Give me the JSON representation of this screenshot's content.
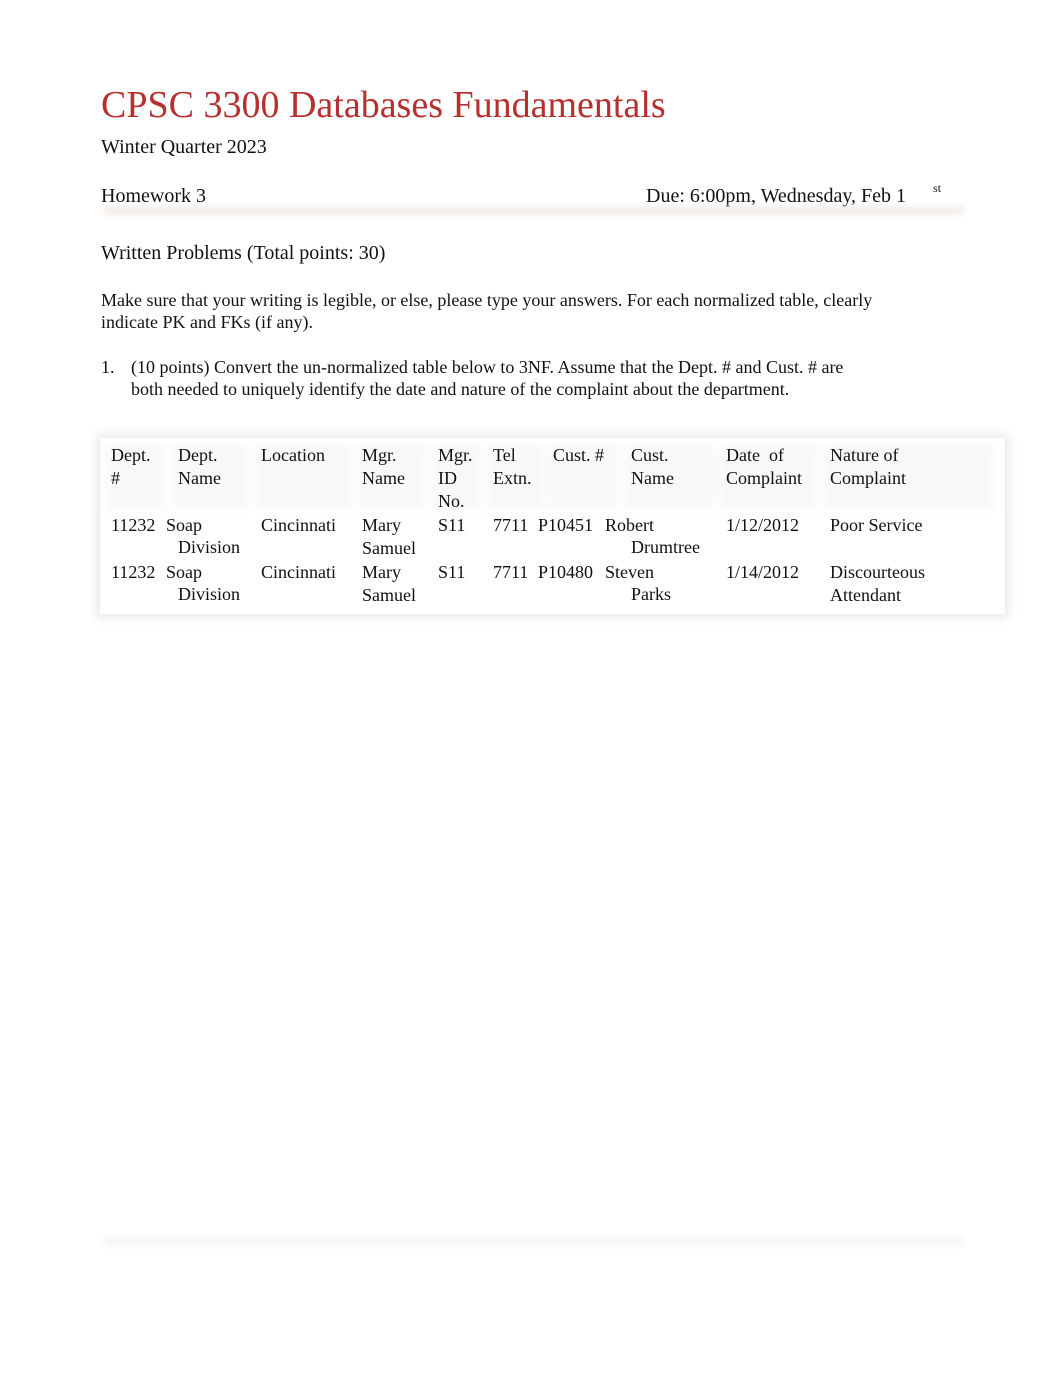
{
  "document": {
    "title": "CPSC 3300 Databases Fundamentals",
    "term": "Winter Quarter 2023",
    "assignment": "Homework 3",
    "due": "Due: 6:00pm, Wednesday, Feb 1",
    "due_suffix": "st",
    "section_heading": "Written Problems (Total points: 30)",
    "instructions": "Make sure that your writing is legible, or else, please type your answers. For each normalized table, clearly indicate PK and FKs (if any).",
    "problems": [
      {
        "number": "1.",
        "text": "(10 points) Convert the un-normalized table below to 3NF. Assume that the Dept. # and Cust. # are both needed to uniquely identify the date and nature of the complaint about the department."
      }
    ]
  },
  "table": {
    "headers": [
      [
        "Dept.",
        "#"
      ],
      [
        "Dept.",
        "Name"
      ],
      [
        "Location"
      ],
      [
        "Mgr.",
        "Name"
      ],
      [
        "Mgr.",
        "ID",
        "No."
      ],
      [
        "Tel",
        "Extn."
      ],
      [
        "Cust. #"
      ],
      [
        "Cust.",
        "Name"
      ],
      [
        "Date  of",
        "Complaint"
      ],
      [
        "Nature of",
        "Complaint"
      ]
    ],
    "rows": [
      {
        "dept_no": "11232",
        "dept_name": [
          "Soap",
          "Division"
        ],
        "location": "Cincinnati",
        "mgr_name": [
          "Mary",
          "Samuel"
        ],
        "mgr_id": "S11",
        "tel_extn": "7711",
        "cust_no": "P10451",
        "cust_name": [
          "Robert",
          "Drumtree"
        ],
        "date": "1/12/2012",
        "nature": [
          "Poor Service"
        ]
      },
      {
        "dept_no": "11232",
        "dept_name": [
          "Soap",
          "Division"
        ],
        "location": "Cincinnati",
        "mgr_name": [
          "Mary",
          "Samuel"
        ],
        "mgr_id": "S11",
        "tel_extn": "7711",
        "cust_no": "P10480",
        "cust_name": [
          "Steven",
          "Parks"
        ],
        "date": "1/14/2012",
        "nature": [
          "Discourteous",
          "Attendant"
        ]
      }
    ]
  },
  "colors": {
    "title": "#b5302e",
    "text": "#111111"
  }
}
